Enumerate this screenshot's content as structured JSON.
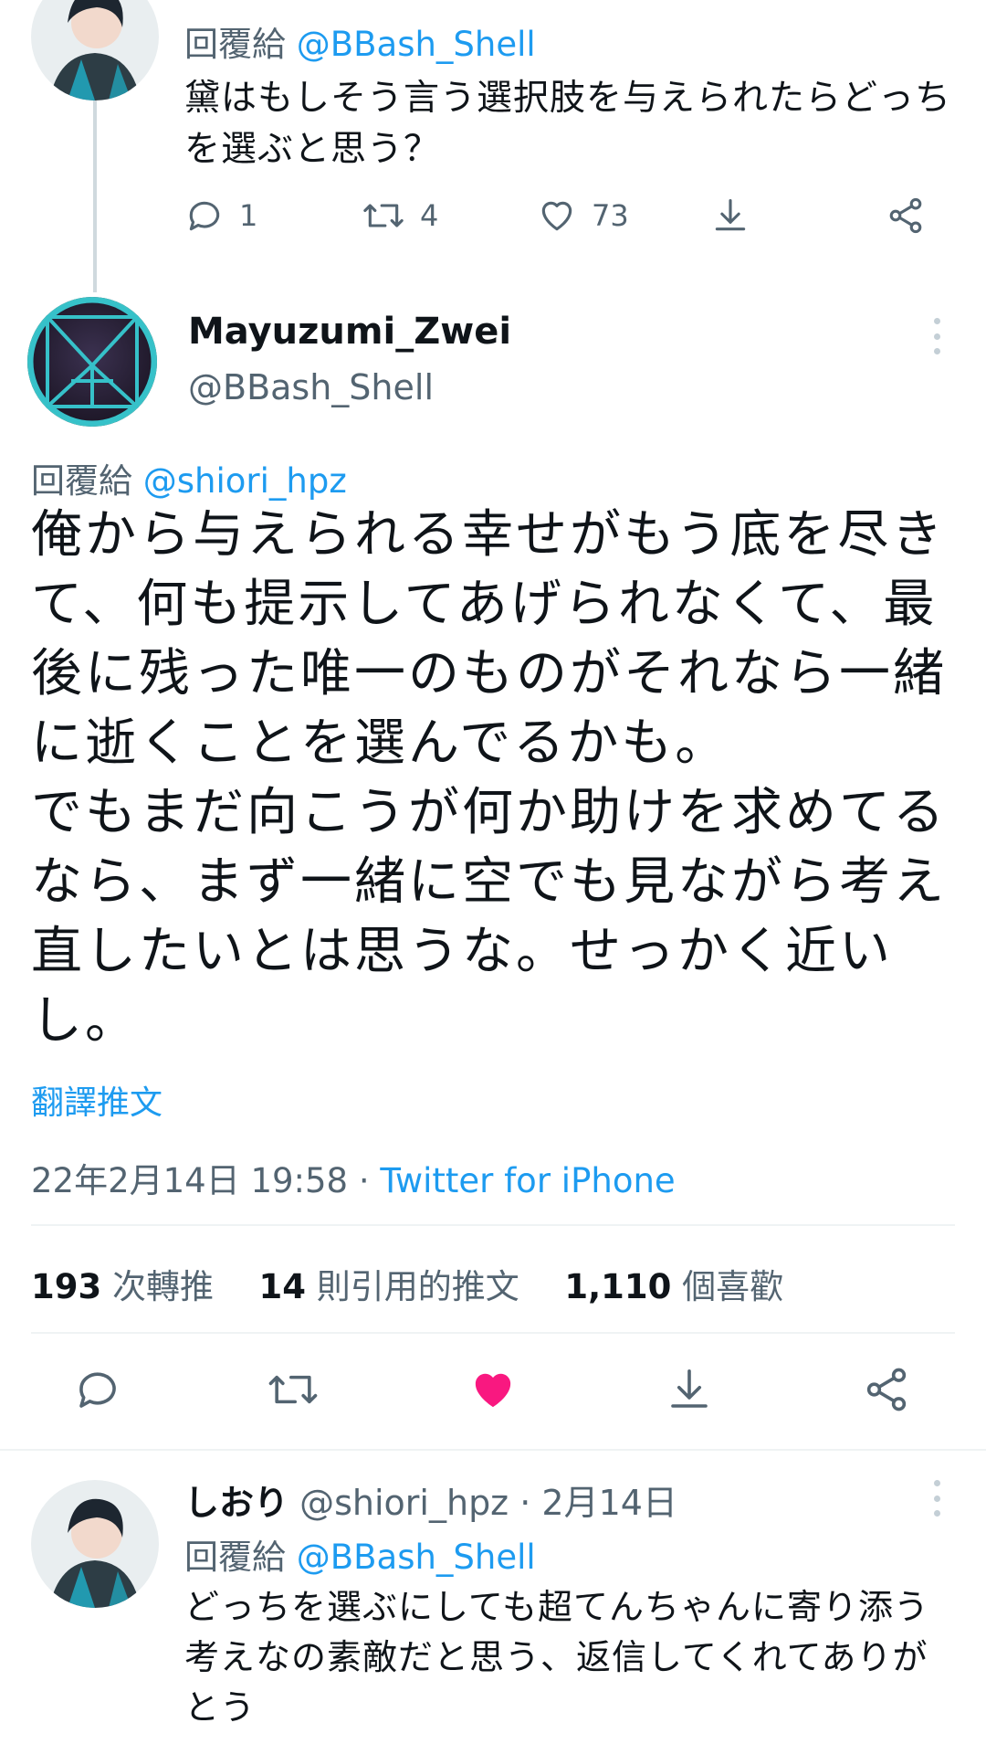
{
  "top_tweet": {
    "reply_prefix": "回覆給",
    "reply_to": "@BBash_Shell",
    "text": "黛はもしそう言う選択肢を与えられたらどっち\nを選ぶと思う？",
    "counts": {
      "replies": "1",
      "retweets": "4",
      "likes": "73"
    }
  },
  "main_tweet": {
    "display_name": "Mayuzumi_Zwei",
    "handle": "@BBash_Shell",
    "reply_prefix": "回覆給",
    "reply_to": "@shiori_hpz",
    "text": "俺から与えられる幸せがもう底を尽き\nて、何も提示してあげられなくて、最\n後に残った唯一のものがそれなら一緒\nに逝くことを選んでるかも。\nでもまだ向こうが何か助けを求めてる\nなら、まず一緒に空でも見ながら考え\n直したいとは思うな。せっかく近い\nし。",
    "translate_label": "翻譯推文",
    "timestamp": "22年2月14日 19:58",
    "separator": "·",
    "source": "Twitter for iPhone",
    "stats": {
      "retweets_count": "193",
      "retweets_label": "次轉推",
      "quotes_count": "14",
      "quotes_label": "則引用的推文",
      "likes_count": "1,110",
      "likes_label": "個喜歡"
    },
    "liked_color": "#f91880"
  },
  "reply_tweet": {
    "display_name": "しおり",
    "handle": "@shiori_hpz",
    "separator": "·",
    "date": "2月14日",
    "reply_prefix": "回覆給",
    "reply_to": "@BBash_Shell",
    "text": "どっちを選ぶにしても超てんちゃんに寄り添う\n考えなの素敵だと思う、返信してくれてありが\nとう"
  },
  "icons": [
    "reply-icon",
    "retweet-icon",
    "like-icon",
    "download-icon",
    "share-icon",
    "more-icon"
  ],
  "colors": {
    "link": "#1d9bf0",
    "secondary": "#536471",
    "like": "#f91880"
  }
}
